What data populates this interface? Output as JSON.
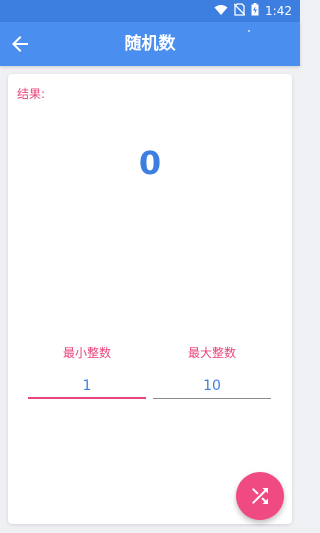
{
  "status_bar": {
    "time": "1:42",
    "icons": [
      "wifi-icon",
      "no-sim-icon",
      "battery-charging-icon"
    ]
  },
  "app_bar": {
    "title": "随机数",
    "back_icon": "arrow-back-icon"
  },
  "result": {
    "label": "结果:",
    "value": "0"
  },
  "fields": {
    "min": {
      "label": "最小整数",
      "value": "1"
    },
    "max": {
      "label": "最大整数",
      "value": "10"
    }
  },
  "fab": {
    "icon": "shuffle-icon"
  },
  "colors": {
    "primary": "#4a8ef0",
    "primary_dark": "#3d7fe0",
    "accent": "#ef4a81",
    "label_pink": "#e8457c"
  }
}
